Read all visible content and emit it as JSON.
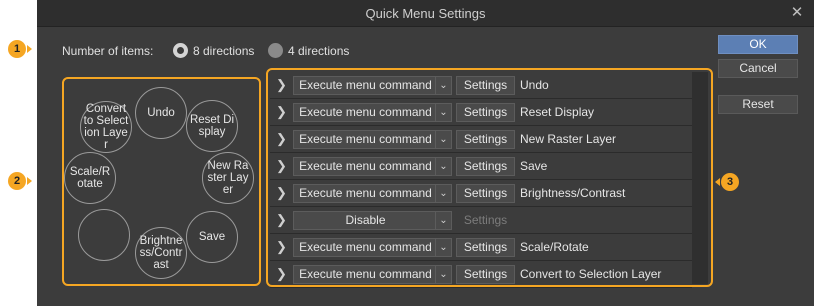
{
  "window": {
    "title": "Quick Menu Settings",
    "close_glyph": "✕"
  },
  "markers": [
    "1",
    "2",
    "3"
  ],
  "items_count": {
    "label": "Number of items:",
    "options": [
      "8 directions",
      "4 directions"
    ],
    "selected": "8 directions"
  },
  "slots": {
    "top": "Undo",
    "top_right": "Reset Display",
    "right": "New Raster Layer",
    "bottom_right": "Save",
    "bottom": "Brightness/Contrast",
    "bottom_left": "",
    "left": "Scale/Rotate",
    "top_left": "Convert to Selection Layer"
  },
  "rows": [
    {
      "mode": "Execute menu command",
      "settings": "Settings",
      "command": "Undo",
      "enabled": true
    },
    {
      "mode": "Execute menu command",
      "settings": "Settings",
      "command": "Reset Display",
      "enabled": true
    },
    {
      "mode": "Execute menu command",
      "settings": "Settings",
      "command": "New Raster Layer",
      "enabled": true
    },
    {
      "mode": "Execute menu command",
      "settings": "Settings",
      "command": "Save",
      "enabled": true
    },
    {
      "mode": "Execute menu command",
      "settings": "Settings",
      "command": "Brightness/Contrast",
      "enabled": true
    },
    {
      "mode": "Disable",
      "settings": "Settings",
      "command": "",
      "enabled": false
    },
    {
      "mode": "Execute menu command",
      "settings": "Settings",
      "command": "Scale/Rotate",
      "enabled": true
    },
    {
      "mode": "Execute menu command",
      "settings": "Settings",
      "command": "Convert to Selection Layer",
      "enabled": true
    }
  ],
  "buttons": {
    "ok": "OK",
    "cancel": "Cancel",
    "reset": "Reset"
  },
  "icons": {
    "expand": "chevron-right-icon",
    "dropdown": "chevron-down-icon",
    "close": "close-icon"
  },
  "colors": {
    "accent_marker": "#f5a623",
    "primary_button": "#5c7fb4",
    "window_bg": "#3c3c3c"
  }
}
